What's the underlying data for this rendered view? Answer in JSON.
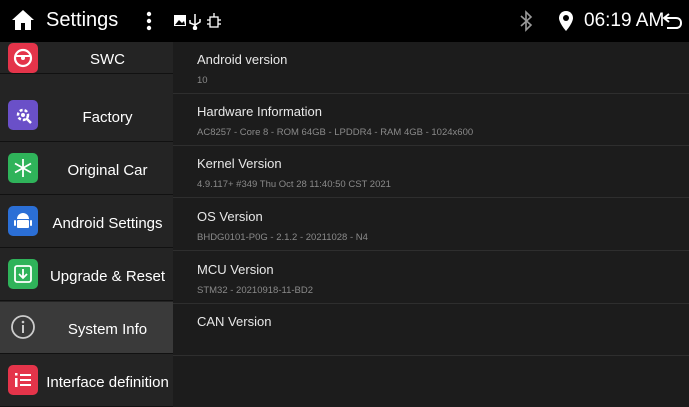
{
  "header": {
    "title": "Settings",
    "time": "06:19 AM",
    "icons": [
      "home-icon",
      "more-vert-icon",
      "image-icon",
      "usb-icon",
      "bluetooth-icon",
      "location-icon",
      "back-icon"
    ]
  },
  "sidebar": {
    "items": [
      {
        "label": "SWC",
        "icon": "steering-wheel-icon",
        "color": "#e4344a"
      },
      {
        "label": "Factory",
        "icon": "gear-icon",
        "color": "#6a50c8"
      },
      {
        "label": "Original Car",
        "icon": "snowflake-icon",
        "color": "#2fb35a"
      },
      {
        "label": "Android Settings",
        "icon": "android-icon",
        "color": "#2b6fd6"
      },
      {
        "label": "Upgrade & Reset",
        "icon": "download-icon",
        "color": "#2fb35a"
      },
      {
        "label": "System Info",
        "icon": "info-icon",
        "color": "#888888",
        "active": true
      },
      {
        "label": "Interface definition",
        "icon": "list-icon",
        "color": "#e4344a"
      }
    ]
  },
  "info": [
    {
      "label": "Android version",
      "value": "10"
    },
    {
      "label": "Hardware Information",
      "value": "AC8257 - Core 8 - ROM 64GB - LPDDR4 - RAM 4GB - 1024x600"
    },
    {
      "label": "Kernel Version",
      "value": "4.9.117+ #349 Thu Oct 28 11:40:50 CST 2021"
    },
    {
      "label": "OS Version",
      "value": "BHDG0101-P0G - 2.1.2 - 20211028 - N4"
    },
    {
      "label": "MCU Version",
      "value": "STM32 - 20210918-11-BD2"
    },
    {
      "label": "CAN Version",
      "value": ""
    }
  ],
  "colors": {
    "accent_red": "#e4344a",
    "sidebar_bg": "#242424",
    "main_bg": "#1c1c1c"
  }
}
